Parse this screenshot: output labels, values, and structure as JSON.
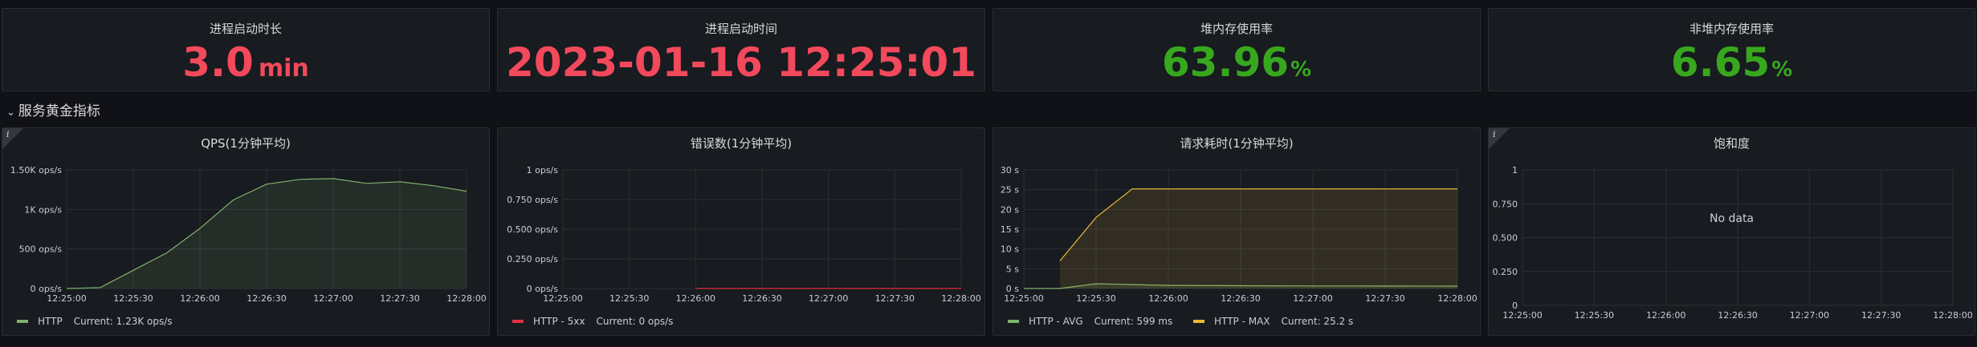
{
  "stats": [
    {
      "title": "进程启动时长",
      "value": "3.0",
      "unit": "min",
      "color": "#f2495c"
    },
    {
      "title": "进程启动时间",
      "value": "2023-01-16 12:25:01",
      "unit": "",
      "color": "#f2495c"
    },
    {
      "title": "堆内存使用率",
      "value": "63.96",
      "unit": "%",
      "color": "#37a81e"
    },
    {
      "title": "非堆内存使用率",
      "value": "6.65",
      "unit": "%",
      "color": "#37a81e"
    }
  ],
  "row": {
    "title": "服务黄金指标",
    "chevron": "chevron-down-icon"
  },
  "info_icon_glyph": "i",
  "graphs": {
    "qps": {
      "title": "QPS(1分钟平均)",
      "legend": [
        {
          "name": "HTTP",
          "current": "Current: 1.23K ops/s",
          "color": "#7eb26d"
        }
      ]
    },
    "errors": {
      "title": "错误数(1分钟平均)",
      "legend": [
        {
          "name": "HTTP - 5xx",
          "current": "Current: 0 ops/s",
          "color": "#e02f44"
        }
      ]
    },
    "latency": {
      "title": "请求耗时(1分钟平均)",
      "legend": [
        {
          "name": "HTTP - AVG",
          "current": "Current: 599 ms",
          "color": "#7eb26d"
        },
        {
          "name": "HTTP - MAX",
          "current": "Current: 25.2 s",
          "color": "#eab839"
        }
      ]
    },
    "saturation": {
      "title": "饱和度",
      "no_data": "No data"
    }
  },
  "chart_data": [
    {
      "type": "area",
      "title": "QPS(1分钟平均)",
      "x": [
        "12:25:00",
        "12:25:15",
        "12:25:30",
        "12:25:45",
        "12:26:00",
        "12:26:15",
        "12:26:30",
        "12:26:45",
        "12:27:00",
        "12:27:15",
        "12:27:30",
        "12:27:45",
        "12:28:00"
      ],
      "x_ticks": [
        "12:25:00",
        "12:25:30",
        "12:26:00",
        "12:26:30",
        "12:27:00",
        "12:27:30",
        "12:28:00"
      ],
      "y_ticks": [
        "0 ops/s",
        "500 ops/s",
        "1K ops/s",
        "1.50K ops/s"
      ],
      "y_tick_values": [
        0,
        500,
        1000,
        1500
      ],
      "ylim": [
        0,
        1500
      ],
      "series": [
        {
          "name": "HTTP",
          "color": "#7eb26d",
          "points": [
            [
              "12:25:00",
              0
            ],
            [
              "12:25:15",
              10
            ],
            [
              "12:25:30",
              230
            ],
            [
              "12:25:45",
              450
            ],
            [
              "12:26:00",
              760
            ],
            [
              "12:26:15",
              1120
            ],
            [
              "12:26:30",
              1320
            ],
            [
              "12:26:45",
              1380
            ],
            [
              "12:27:00",
              1390
            ],
            [
              "12:27:15",
              1330
            ],
            [
              "12:27:30",
              1350
            ],
            [
              "12:27:45",
              1300
            ],
            [
              "12:28:00",
              1230
            ]
          ]
        }
      ]
    },
    {
      "type": "line",
      "title": "错误数(1分钟平均)",
      "x_ticks": [
        "12:25:00",
        "12:25:30",
        "12:26:00",
        "12:26:30",
        "12:27:00",
        "12:27:30",
        "12:28:00"
      ],
      "y_ticks": [
        "0 ops/s",
        "0.250 ops/s",
        "0.500 ops/s",
        "0.750 ops/s",
        "1 ops/s"
      ],
      "y_tick_values": [
        0,
        0.25,
        0.5,
        0.75,
        1
      ],
      "ylim": [
        0,
        1
      ],
      "series": [
        {
          "name": "HTTP - 5xx",
          "color": "#e02f44",
          "points": [
            [
              "12:26:00",
              0
            ],
            [
              "12:28:00",
              0
            ]
          ]
        }
      ]
    },
    {
      "type": "area",
      "title": "请求耗时(1分钟平均)",
      "x_ticks": [
        "12:25:00",
        "12:25:30",
        "12:26:00",
        "12:26:30",
        "12:27:00",
        "12:27:30",
        "12:28:00"
      ],
      "y_ticks": [
        "0 s",
        "5 s",
        "10 s",
        "15 s",
        "20 s",
        "25 s",
        "30 s"
      ],
      "y_tick_values": [
        0,
        5,
        10,
        15,
        20,
        25,
        30
      ],
      "ylim": [
        0,
        30
      ],
      "series": [
        {
          "name": "HTTP - AVG",
          "color": "#7eb26d",
          "points": [
            [
              "12:25:00",
              0
            ],
            [
              "12:25:15",
              0
            ],
            [
              "12:25:30",
              1.2
            ],
            [
              "12:25:45",
              1.0
            ],
            [
              "12:26:00",
              0.8
            ],
            [
              "12:26:30",
              0.7
            ],
            [
              "12:27:00",
              0.65
            ],
            [
              "12:27:30",
              0.62
            ],
            [
              "12:28:00",
              0.6
            ]
          ]
        },
        {
          "name": "HTTP - MAX",
          "color": "#eab839",
          "points": [
            [
              "12:25:15",
              7
            ],
            [
              "12:25:30",
              18
            ],
            [
              "12:25:45",
              25.2
            ],
            [
              "12:26:00",
              25.2
            ],
            [
              "12:26:30",
              25.2
            ],
            [
              "12:27:00",
              25.2
            ],
            [
              "12:27:30",
              25.2
            ],
            [
              "12:28:00",
              25.2
            ]
          ]
        }
      ]
    },
    {
      "type": "line",
      "title": "饱和度",
      "x_ticks": [
        "12:25:00",
        "12:25:30",
        "12:26:00",
        "12:26:30",
        "12:27:00",
        "12:27:30",
        "12:28:00"
      ],
      "y_ticks": [
        "0",
        "0.250",
        "0.500",
        "0.750",
        "1"
      ],
      "y_tick_values": [
        0,
        0.25,
        0.5,
        0.75,
        1
      ],
      "ylim": [
        0,
        1
      ],
      "series": []
    }
  ]
}
